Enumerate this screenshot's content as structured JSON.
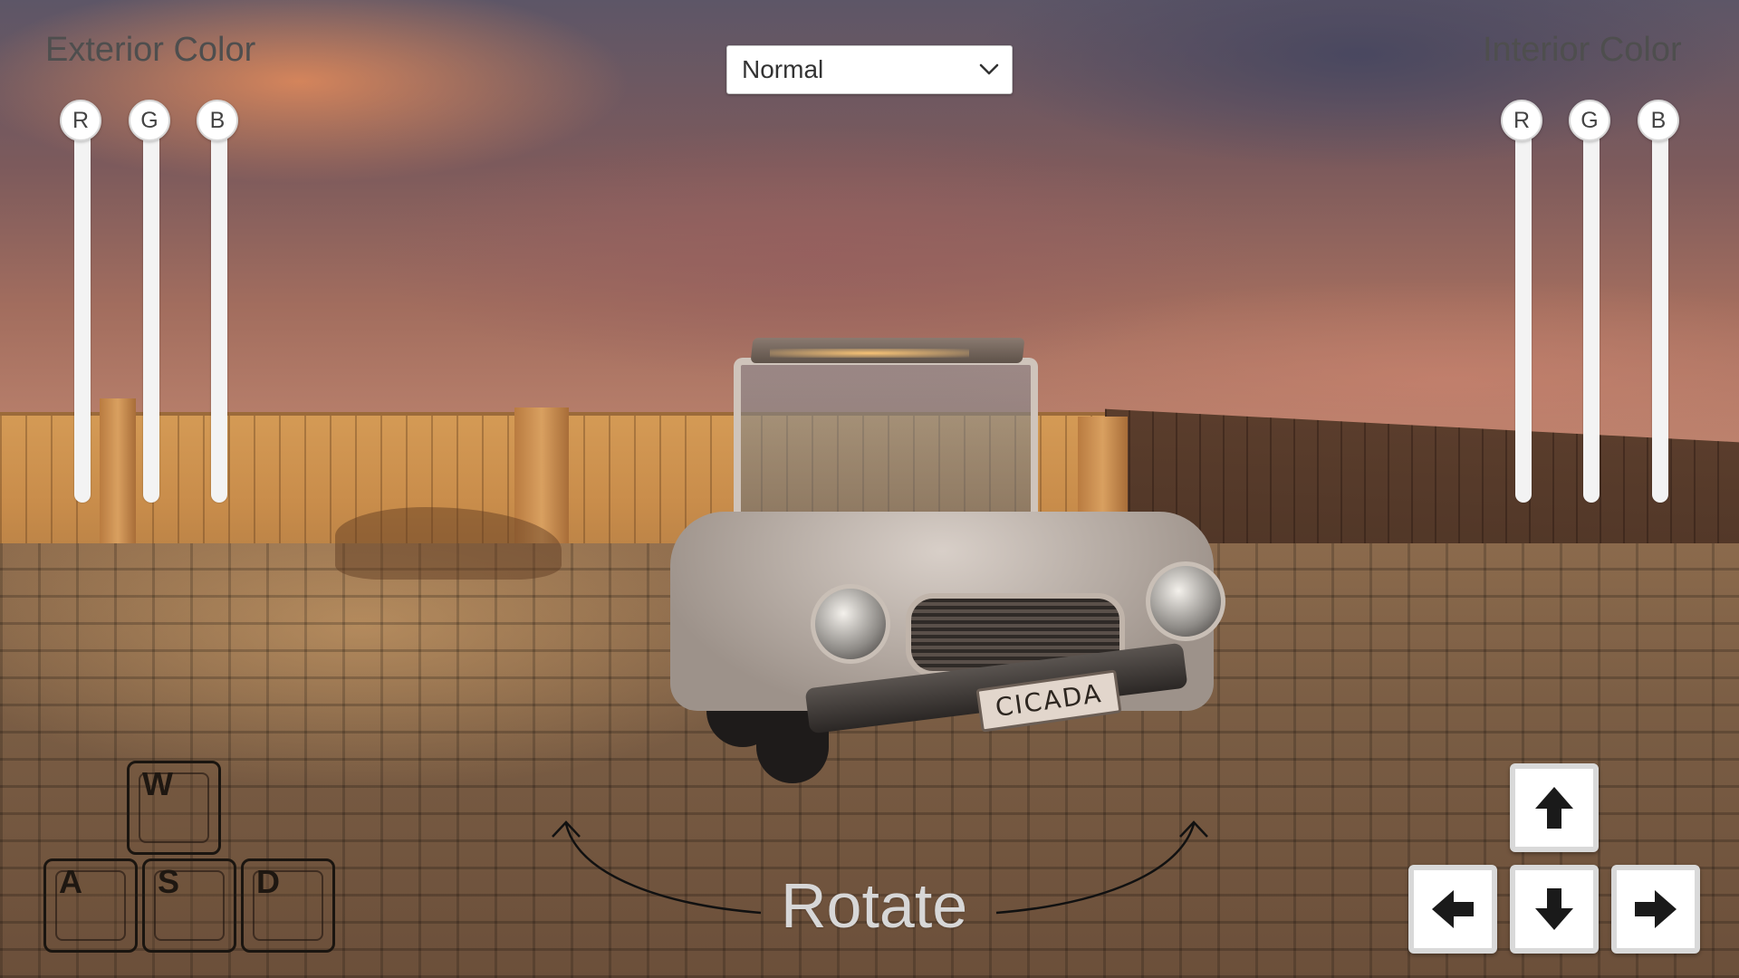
{
  "exterior": {
    "title": "Exterior Color",
    "sliders": [
      {
        "label": "R",
        "value": 1.0
      },
      {
        "label": "G",
        "value": 1.0
      },
      {
        "label": "B",
        "value": 1.0
      }
    ]
  },
  "interior": {
    "title": "Interior Color",
    "sliders": [
      {
        "label": "R",
        "value": 1.0
      },
      {
        "label": "G",
        "value": 1.0
      },
      {
        "label": "B",
        "value": 1.0
      }
    ]
  },
  "mode_dropdown": {
    "selected": "Normal"
  },
  "wasd": {
    "w": "W",
    "a": "A",
    "s": "S",
    "d": "D"
  },
  "rotate": {
    "label": "Rotate"
  },
  "car": {
    "plate": "CICADA"
  },
  "arrow_keys": {
    "up": "arrow-up-icon",
    "left": "arrow-left-icon",
    "down": "arrow-down-icon",
    "right": "arrow-right-icon"
  }
}
